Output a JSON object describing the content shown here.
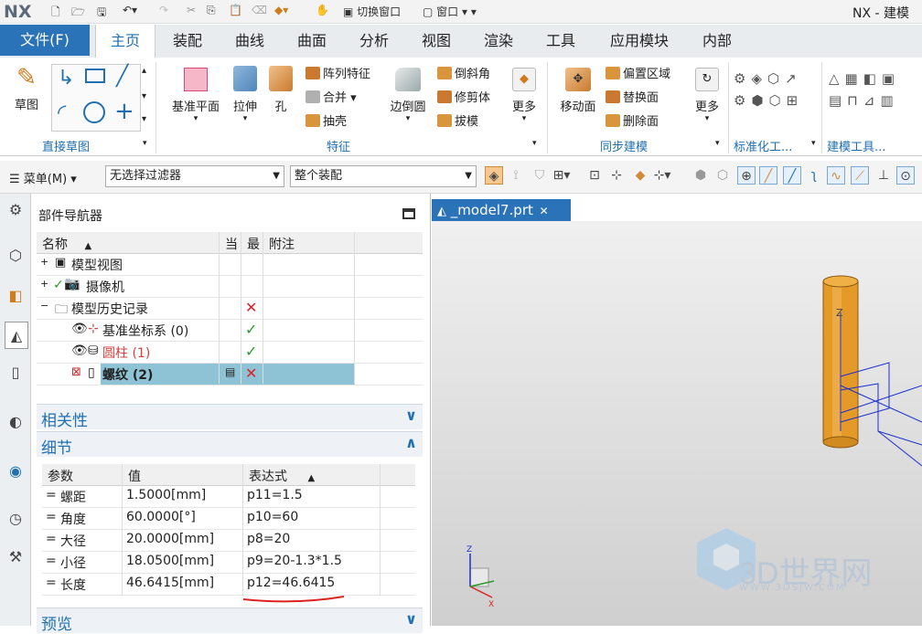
{
  "titlebar": {
    "logo": "NX",
    "app_title": "NX - 建模",
    "switch_window": "切换窗口",
    "window_menu": "窗口"
  },
  "tabs": {
    "file": "文件(F)",
    "items": [
      "主页",
      "装配",
      "曲线",
      "曲面",
      "分析",
      "视图",
      "渲染",
      "工具",
      "应用模块",
      "内部"
    ]
  },
  "ribbon": {
    "sketch": "草图",
    "direct_sketch": "直接草图",
    "datum_plane": "基准平面",
    "extrude": "拉伸",
    "hole": "孔",
    "pattern": "阵列特征",
    "unite": "合并",
    "shell": "抽壳",
    "edge_blend": "边倒圆",
    "chamfer": "倒斜角",
    "trim_body": "修剪体",
    "draft": "拔模",
    "more": "更多",
    "feature": "特征",
    "move_face": "移动面",
    "offset_region": "偏置区域",
    "replace_face": "替换面",
    "delete_face": "删除面",
    "sync": "同步建模",
    "std": "标准化工...",
    "modeling_tools": "建模工具..."
  },
  "selbar": {
    "menu": "菜单(M)",
    "filter": "无选择过滤器",
    "scope": "整个装配"
  },
  "navigator": {
    "title": "部件导航器",
    "headers": {
      "name": "名称",
      "current": "当",
      "latest": "最",
      "comment": "附注"
    },
    "rows": [
      {
        "label": "模型视图"
      },
      {
        "label": "摄像机"
      },
      {
        "label": "模型历史记录"
      },
      {
        "label": "基准坐标系 (0)"
      },
      {
        "label": "圆柱 (1)"
      },
      {
        "label": "螺纹 (2)"
      }
    ],
    "dependency": "相关性",
    "details": "细节",
    "preview": "预览",
    "detail_headers": {
      "param": "参数",
      "value": "值",
      "expr": "表达式"
    },
    "details_rows": [
      {
        "eq": "=",
        "param": "螺距",
        "value": "1.5000[mm]",
        "expr": "p11=1.5"
      },
      {
        "eq": "=",
        "param": "角度",
        "value": "60.0000[°]",
        "expr": "p10=60"
      },
      {
        "eq": "=",
        "param": "大径",
        "value": "20.0000[mm]",
        "expr": "p8=20"
      },
      {
        "eq": "=",
        "param": "小径",
        "value": "18.0500[mm]",
        "expr": "p9=20-1.3*1.5"
      },
      {
        "eq": "=",
        "param": "长度",
        "value": "46.6415[mm]",
        "expr": "p12=46.6415"
      }
    ]
  },
  "graphics": {
    "tab": "_model7.prt",
    "axis_z": "Z",
    "axis_x": "X",
    "watermark": "3D世界网",
    "watermark_url": "WWW.3DSJW.COM"
  }
}
